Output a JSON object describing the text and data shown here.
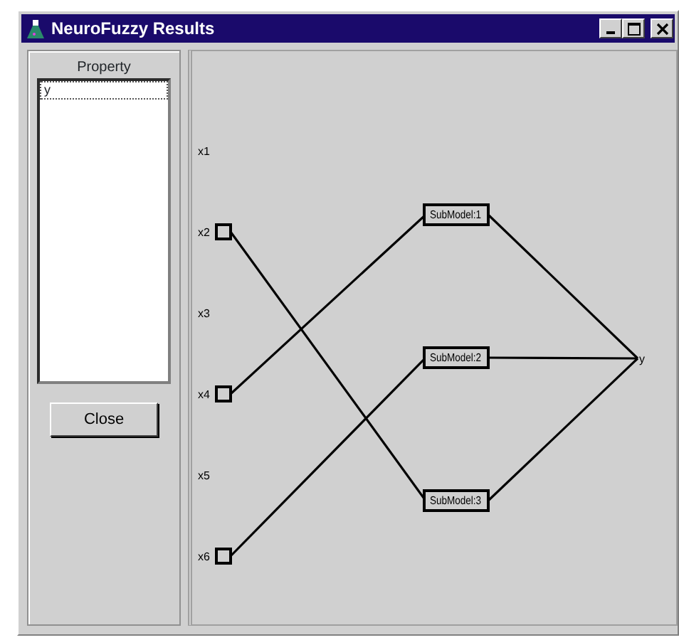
{
  "window": {
    "title": "NeuroFuzzy Results"
  },
  "property": {
    "label": "Property",
    "items": [
      {
        "text": "y",
        "selected": true
      }
    ]
  },
  "close_button": "Close",
  "network": {
    "inputs": [
      {
        "label": "x1",
        "connected": false
      },
      {
        "label": "x2",
        "connected": true
      },
      {
        "label": "x3",
        "connected": false
      },
      {
        "label": "x4",
        "connected": true
      },
      {
        "label": "x5",
        "connected": false
      },
      {
        "label": "x6",
        "connected": true
      }
    ],
    "submodels": [
      {
        "label": "SubModel:1"
      },
      {
        "label": "SubModel:2"
      },
      {
        "label": "SubModel:3"
      }
    ],
    "output": "y"
  }
}
